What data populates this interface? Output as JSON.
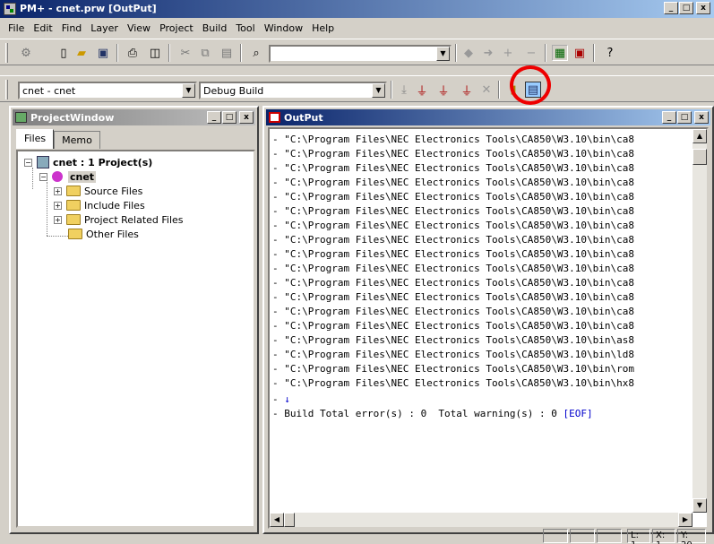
{
  "window": {
    "title": "PM+ - cnet.prw [OutPut]",
    "min_label": "_",
    "max_label": "□",
    "close_label": "x"
  },
  "menu": [
    "File",
    "Edit",
    "Find",
    "Layer",
    "View",
    "Project",
    "Build",
    "Tool",
    "Window",
    "Help"
  ],
  "toolbar": {
    "project_select": "cnet - cnet",
    "build_select": "Debug Build",
    "search_value": ""
  },
  "project_window": {
    "title": "ProjectWindow",
    "tabs": [
      "Files",
      "Memo"
    ],
    "tree": {
      "root": "cnet : 1 Project(s)",
      "project": "cnet",
      "folders": [
        "Source Files",
        "Include Files",
        "Project Related Files",
        "Other Files"
      ]
    }
  },
  "output_window": {
    "title": "OutPut",
    "lines": [
      "- \"C:\\Program Files\\NEC Electronics Tools\\CA850\\W3.10\\bin\\ca8",
      "- \"C:\\Program Files\\NEC Electronics Tools\\CA850\\W3.10\\bin\\ca8",
      "- \"C:\\Program Files\\NEC Electronics Tools\\CA850\\W3.10\\bin\\ca8",
      "- \"C:\\Program Files\\NEC Electronics Tools\\CA850\\W3.10\\bin\\ca8",
      "- \"C:\\Program Files\\NEC Electronics Tools\\CA850\\W3.10\\bin\\ca8",
      "- \"C:\\Program Files\\NEC Electronics Tools\\CA850\\W3.10\\bin\\ca8",
      "- \"C:\\Program Files\\NEC Electronics Tools\\CA850\\W3.10\\bin\\ca8",
      "- \"C:\\Program Files\\NEC Electronics Tools\\CA850\\W3.10\\bin\\ca8",
      "- \"C:\\Program Files\\NEC Electronics Tools\\CA850\\W3.10\\bin\\ca8",
      "- \"C:\\Program Files\\NEC Electronics Tools\\CA850\\W3.10\\bin\\ca8",
      "- \"C:\\Program Files\\NEC Electronics Tools\\CA850\\W3.10\\bin\\ca8",
      "- \"C:\\Program Files\\NEC Electronics Tools\\CA850\\W3.10\\bin\\ca8",
      "- \"C:\\Program Files\\NEC Electronics Tools\\CA850\\W3.10\\bin\\ca8",
      "- \"C:\\Program Files\\NEC Electronics Tools\\CA850\\W3.10\\bin\\ca8",
      "- \"C:\\Program Files\\NEC Electronics Tools\\CA850\\W3.10\\bin\\as8",
      "- \"C:\\Program Files\\NEC Electronics Tools\\CA850\\W3.10\\bin\\ld8",
      "- \"C:\\Program Files\\NEC Electronics Tools\\CA850\\W3.10\\bin\\rom",
      "- \"C:\\Program Files\\NEC Electronics Tools\\CA850\\W3.10\\bin\\hx8"
    ],
    "arrow_prefix": "- ",
    "arrow_glyph": "↓",
    "summary_prefix": "- Build Total error(s) : 0  Total warning(s) : 0 ",
    "summary_eof": "[EOF]"
  },
  "status": {
    "line": "L: 1",
    "col": "X: 1",
    "pos": "Y: 20"
  }
}
